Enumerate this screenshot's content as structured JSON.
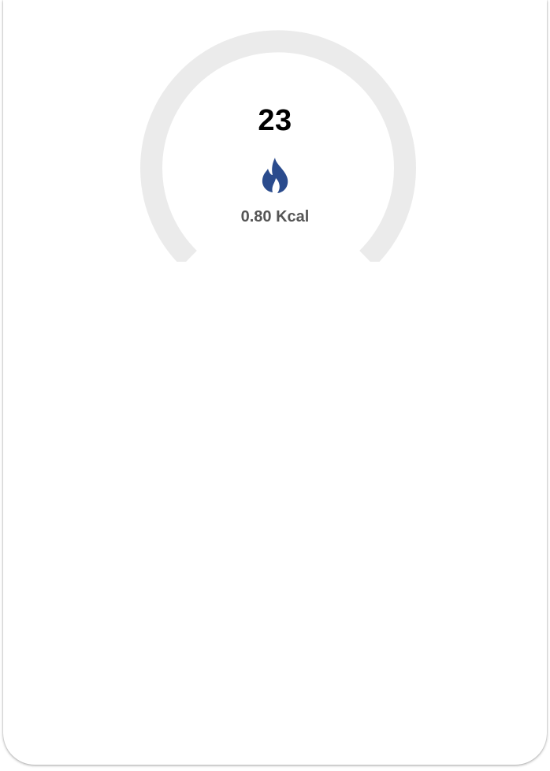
{
  "gauge": {
    "value": "23",
    "track_color": "#ebebeb",
    "icon": "flame-icon",
    "icon_color": "#2a4b8d",
    "calories": "0.80 Kcal"
  }
}
